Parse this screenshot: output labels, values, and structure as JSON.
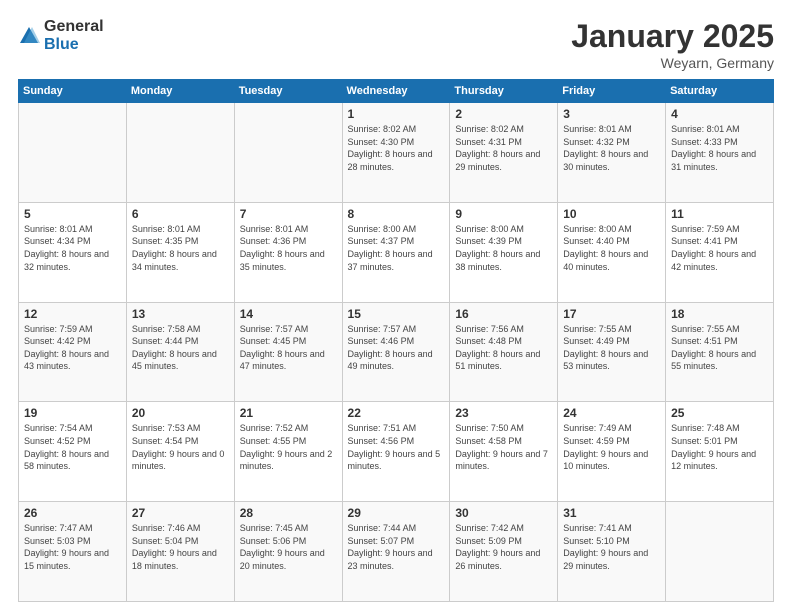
{
  "logo": {
    "general": "General",
    "blue": "Blue"
  },
  "title": "January 2025",
  "subtitle": "Weyarn, Germany",
  "headers": [
    "Sunday",
    "Monday",
    "Tuesday",
    "Wednesday",
    "Thursday",
    "Friday",
    "Saturday"
  ],
  "weeks": [
    [
      {
        "day": "",
        "sunrise": "",
        "sunset": "",
        "daylight": ""
      },
      {
        "day": "",
        "sunrise": "",
        "sunset": "",
        "daylight": ""
      },
      {
        "day": "",
        "sunrise": "",
        "sunset": "",
        "daylight": ""
      },
      {
        "day": "1",
        "sunrise": "Sunrise: 8:02 AM",
        "sunset": "Sunset: 4:30 PM",
        "daylight": "Daylight: 8 hours and 28 minutes."
      },
      {
        "day": "2",
        "sunrise": "Sunrise: 8:02 AM",
        "sunset": "Sunset: 4:31 PM",
        "daylight": "Daylight: 8 hours and 29 minutes."
      },
      {
        "day": "3",
        "sunrise": "Sunrise: 8:01 AM",
        "sunset": "Sunset: 4:32 PM",
        "daylight": "Daylight: 8 hours and 30 minutes."
      },
      {
        "day": "4",
        "sunrise": "Sunrise: 8:01 AM",
        "sunset": "Sunset: 4:33 PM",
        "daylight": "Daylight: 8 hours and 31 minutes."
      }
    ],
    [
      {
        "day": "5",
        "sunrise": "Sunrise: 8:01 AM",
        "sunset": "Sunset: 4:34 PM",
        "daylight": "Daylight: 8 hours and 32 minutes."
      },
      {
        "day": "6",
        "sunrise": "Sunrise: 8:01 AM",
        "sunset": "Sunset: 4:35 PM",
        "daylight": "Daylight: 8 hours and 34 minutes."
      },
      {
        "day": "7",
        "sunrise": "Sunrise: 8:01 AM",
        "sunset": "Sunset: 4:36 PM",
        "daylight": "Daylight: 8 hours and 35 minutes."
      },
      {
        "day": "8",
        "sunrise": "Sunrise: 8:00 AM",
        "sunset": "Sunset: 4:37 PM",
        "daylight": "Daylight: 8 hours and 37 minutes."
      },
      {
        "day": "9",
        "sunrise": "Sunrise: 8:00 AM",
        "sunset": "Sunset: 4:39 PM",
        "daylight": "Daylight: 8 hours and 38 minutes."
      },
      {
        "day": "10",
        "sunrise": "Sunrise: 8:00 AM",
        "sunset": "Sunset: 4:40 PM",
        "daylight": "Daylight: 8 hours and 40 minutes."
      },
      {
        "day": "11",
        "sunrise": "Sunrise: 7:59 AM",
        "sunset": "Sunset: 4:41 PM",
        "daylight": "Daylight: 8 hours and 42 minutes."
      }
    ],
    [
      {
        "day": "12",
        "sunrise": "Sunrise: 7:59 AM",
        "sunset": "Sunset: 4:42 PM",
        "daylight": "Daylight: 8 hours and 43 minutes."
      },
      {
        "day": "13",
        "sunrise": "Sunrise: 7:58 AM",
        "sunset": "Sunset: 4:44 PM",
        "daylight": "Daylight: 8 hours and 45 minutes."
      },
      {
        "day": "14",
        "sunrise": "Sunrise: 7:57 AM",
        "sunset": "Sunset: 4:45 PM",
        "daylight": "Daylight: 8 hours and 47 minutes."
      },
      {
        "day": "15",
        "sunrise": "Sunrise: 7:57 AM",
        "sunset": "Sunset: 4:46 PM",
        "daylight": "Daylight: 8 hours and 49 minutes."
      },
      {
        "day": "16",
        "sunrise": "Sunrise: 7:56 AM",
        "sunset": "Sunset: 4:48 PM",
        "daylight": "Daylight: 8 hours and 51 minutes."
      },
      {
        "day": "17",
        "sunrise": "Sunrise: 7:55 AM",
        "sunset": "Sunset: 4:49 PM",
        "daylight": "Daylight: 8 hours and 53 minutes."
      },
      {
        "day": "18",
        "sunrise": "Sunrise: 7:55 AM",
        "sunset": "Sunset: 4:51 PM",
        "daylight": "Daylight: 8 hours and 55 minutes."
      }
    ],
    [
      {
        "day": "19",
        "sunrise": "Sunrise: 7:54 AM",
        "sunset": "Sunset: 4:52 PM",
        "daylight": "Daylight: 8 hours and 58 minutes."
      },
      {
        "day": "20",
        "sunrise": "Sunrise: 7:53 AM",
        "sunset": "Sunset: 4:54 PM",
        "daylight": "Daylight: 9 hours and 0 minutes."
      },
      {
        "day": "21",
        "sunrise": "Sunrise: 7:52 AM",
        "sunset": "Sunset: 4:55 PM",
        "daylight": "Daylight: 9 hours and 2 minutes."
      },
      {
        "day": "22",
        "sunrise": "Sunrise: 7:51 AM",
        "sunset": "Sunset: 4:56 PM",
        "daylight": "Daylight: 9 hours and 5 minutes."
      },
      {
        "day": "23",
        "sunrise": "Sunrise: 7:50 AM",
        "sunset": "Sunset: 4:58 PM",
        "daylight": "Daylight: 9 hours and 7 minutes."
      },
      {
        "day": "24",
        "sunrise": "Sunrise: 7:49 AM",
        "sunset": "Sunset: 4:59 PM",
        "daylight": "Daylight: 9 hours and 10 minutes."
      },
      {
        "day": "25",
        "sunrise": "Sunrise: 7:48 AM",
        "sunset": "Sunset: 5:01 PM",
        "daylight": "Daylight: 9 hours and 12 minutes."
      }
    ],
    [
      {
        "day": "26",
        "sunrise": "Sunrise: 7:47 AM",
        "sunset": "Sunset: 5:03 PM",
        "daylight": "Daylight: 9 hours and 15 minutes."
      },
      {
        "day": "27",
        "sunrise": "Sunrise: 7:46 AM",
        "sunset": "Sunset: 5:04 PM",
        "daylight": "Daylight: 9 hours and 18 minutes."
      },
      {
        "day": "28",
        "sunrise": "Sunrise: 7:45 AM",
        "sunset": "Sunset: 5:06 PM",
        "daylight": "Daylight: 9 hours and 20 minutes."
      },
      {
        "day": "29",
        "sunrise": "Sunrise: 7:44 AM",
        "sunset": "Sunset: 5:07 PM",
        "daylight": "Daylight: 9 hours and 23 minutes."
      },
      {
        "day": "30",
        "sunrise": "Sunrise: 7:42 AM",
        "sunset": "Sunset: 5:09 PM",
        "daylight": "Daylight: 9 hours and 26 minutes."
      },
      {
        "day": "31",
        "sunrise": "Sunrise: 7:41 AM",
        "sunset": "Sunset: 5:10 PM",
        "daylight": "Daylight: 9 hours and 29 minutes."
      },
      {
        "day": "",
        "sunrise": "",
        "sunset": "",
        "daylight": ""
      }
    ]
  ]
}
